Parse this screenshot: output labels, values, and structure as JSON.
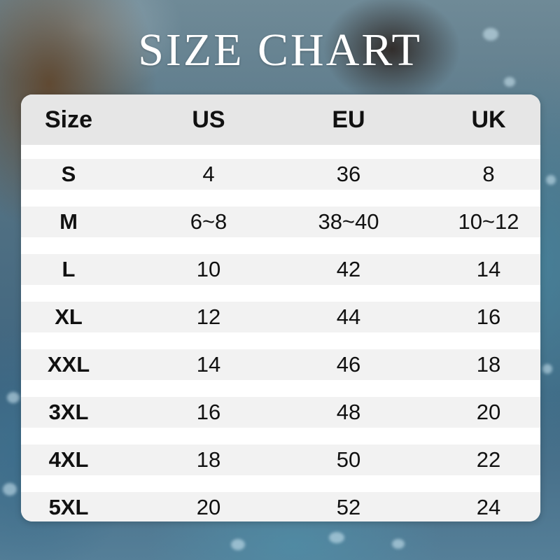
{
  "title": "SIZE CHART",
  "table": {
    "headers": [
      "Size",
      "US",
      "EU",
      "UK"
    ],
    "rows": [
      {
        "size": "S",
        "us": "4",
        "eu": "36",
        "uk": "8"
      },
      {
        "size": "M",
        "us": "6~8",
        "eu": "38~40",
        "uk": "10~12"
      },
      {
        "size": "L",
        "us": "10",
        "eu": "42",
        "uk": "14"
      },
      {
        "size": "XL",
        "us": "12",
        "eu": "44",
        "uk": "16"
      },
      {
        "size": "XXL",
        "us": "14",
        "eu": "46",
        "uk": "18"
      },
      {
        "size": "3XL",
        "us": "16",
        "eu": "48",
        "uk": "20"
      },
      {
        "size": "4XL",
        "us": "18",
        "eu": "50",
        "uk": "22"
      },
      {
        "size": "5XL",
        "us": "20",
        "eu": "52",
        "uk": "24"
      }
    ]
  },
  "colors": {
    "header_bg": "#e6e6e6",
    "row_bg": "#f2f2f2",
    "card_bg": "#ffffff",
    "title_color": "#ffffff"
  }
}
